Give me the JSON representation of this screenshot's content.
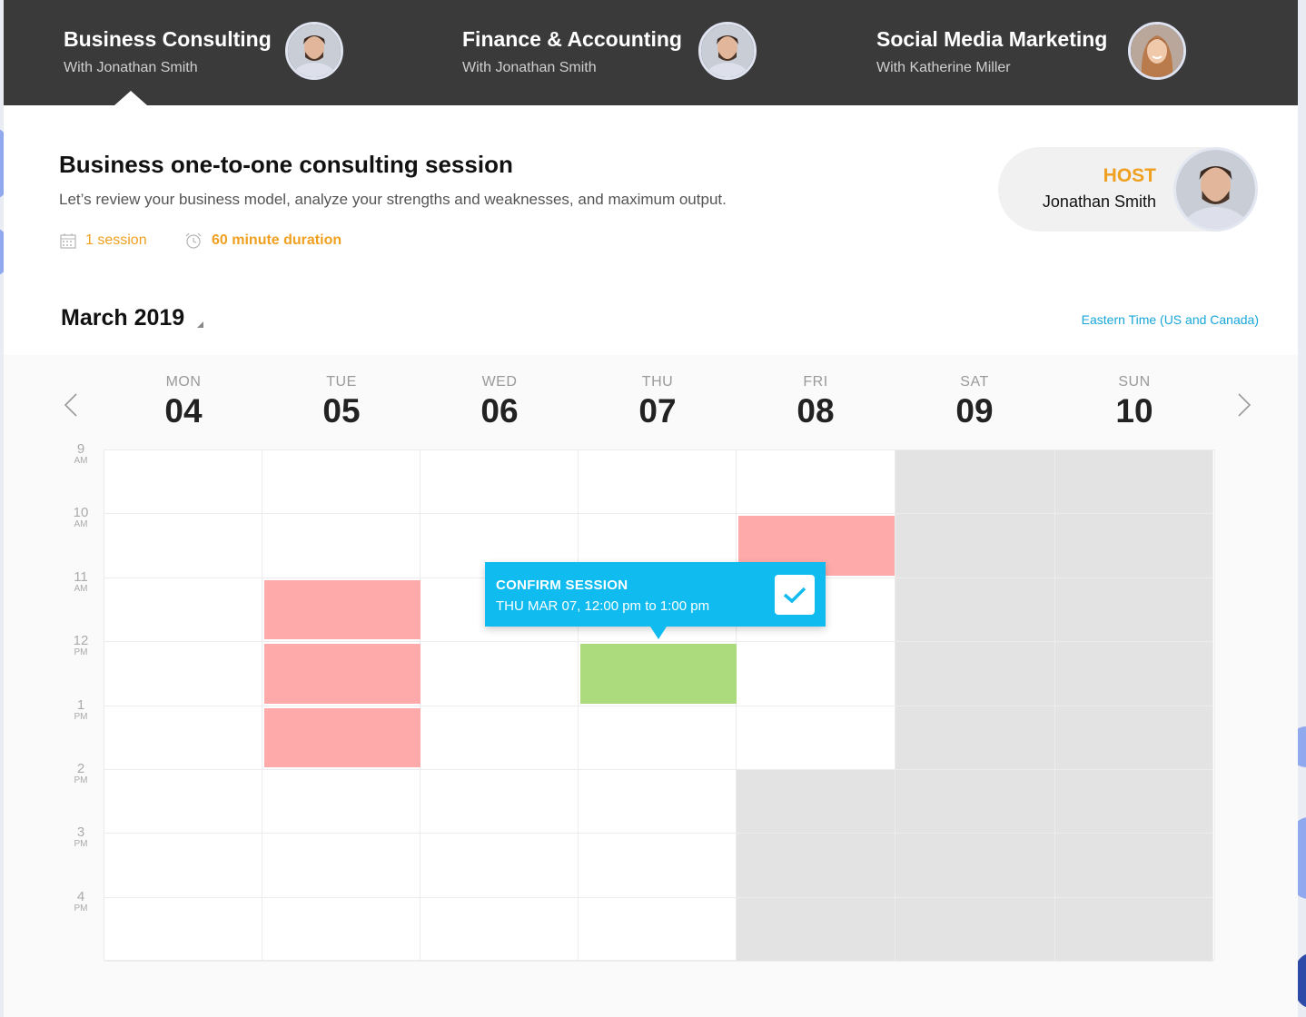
{
  "courses": [
    {
      "title": "Business Consulting",
      "host": "With Jonathan Smith",
      "active": true
    },
    {
      "title": "Finance & Accounting",
      "host": "With Jonathan Smith",
      "active": false
    },
    {
      "title": "Social Media Marketing",
      "host": "With Katherine Miller",
      "active": false
    }
  ],
  "session": {
    "title": "Business one-to-one consulting session",
    "description": "Let’s review your business model, analyze your strengths and weaknesses, and maximum output.",
    "sessions_label": "1 session",
    "duration_label": "60 minute duration"
  },
  "host": {
    "label": "HOST",
    "name": "Jonathan Smith"
  },
  "calendar": {
    "month": "March 2019",
    "timezone": "Eastern Time (US and Canada)",
    "days": [
      {
        "name": "MON",
        "num": "04"
      },
      {
        "name": "TUE",
        "num": "05"
      },
      {
        "name": "WED",
        "num": "06"
      },
      {
        "name": "THU",
        "num": "07"
      },
      {
        "name": "FRI",
        "num": "08"
      },
      {
        "name": "SAT",
        "num": "09"
      },
      {
        "name": "SUN",
        "num": "10"
      }
    ],
    "times": [
      {
        "hour": "9",
        "ampm": "AM"
      },
      {
        "hour": "10",
        "ampm": "AM"
      },
      {
        "hour": "11",
        "ampm": "AM"
      },
      {
        "hour": "12",
        "ampm": "PM"
      },
      {
        "hour": "1",
        "ampm": "PM"
      },
      {
        "hour": "2",
        "ampm": "PM"
      },
      {
        "hour": "3",
        "ampm": "PM"
      },
      {
        "hour": "4",
        "ampm": "PM"
      }
    ]
  },
  "confirm": {
    "title": "CONFIRM SESSION",
    "detail": "THU MAR 07, 12:00 pm to 1:00 pm"
  },
  "colors": {
    "accent": "#f0a020",
    "link": "#18a6d9",
    "tooltip": "#10bbef",
    "booked": "#ffaaaa",
    "selected": "#acdb7d",
    "unavailable": "#e3e3e3",
    "header": "#3a3a3a"
  }
}
